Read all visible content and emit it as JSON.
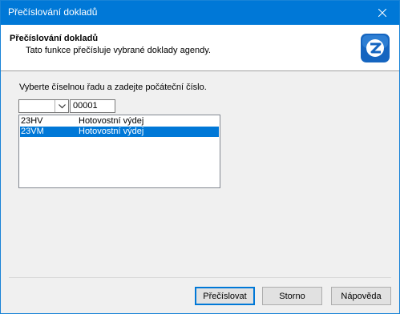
{
  "window": {
    "title": "Přečíslování dokladů"
  },
  "header": {
    "title": "Přečíslování dokladů",
    "subtitle": "Tato funkce přečísluje vybrané doklady agendy.",
    "logo_icon": "z-logo-icon"
  },
  "form": {
    "prompt": "Vyberte číselnou řadu a zadejte počáteční číslo.",
    "series_combo_value": "",
    "start_number": "00001"
  },
  "series_list": [
    {
      "code": "23HV",
      "name": "Hotovostní výdej",
      "selected": false
    },
    {
      "code": "23VM",
      "name": "Hotovostní výdej",
      "selected": true
    }
  ],
  "buttons": {
    "renumber": "Přečíslovat",
    "cancel": "Storno",
    "help": "Nápověda"
  },
  "colors": {
    "accent": "#0078d7"
  }
}
